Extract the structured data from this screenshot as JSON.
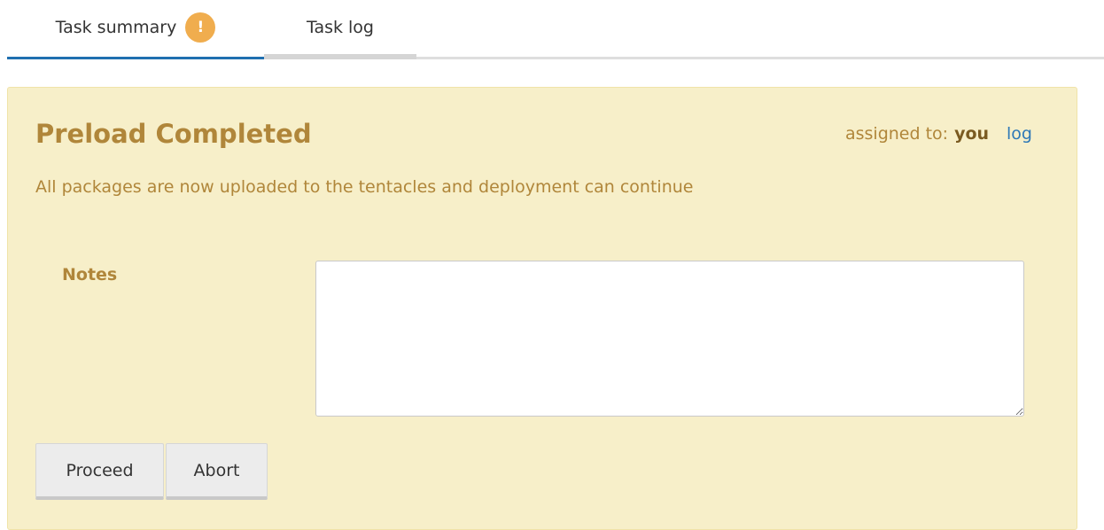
{
  "tabs": {
    "summary_label": "Task summary",
    "summary_badge": "!",
    "log_label": "Task log"
  },
  "panel": {
    "title": "Preload Completed",
    "assigned_prefix": "assigned to:",
    "assigned_user": "you",
    "log_link": "log",
    "description": "All packages are now uploaded to the tentacles and deployment can continue",
    "notes_label": "Notes",
    "notes_value": "",
    "proceed_label": "Proceed",
    "abort_label": "Abort"
  },
  "colors": {
    "panel_background": "#f7efc9",
    "warning_text": "#b0863a",
    "active_tab_underline": "#1f6fb0",
    "badge": "#f0ad4e",
    "link": "#2e78b7"
  }
}
